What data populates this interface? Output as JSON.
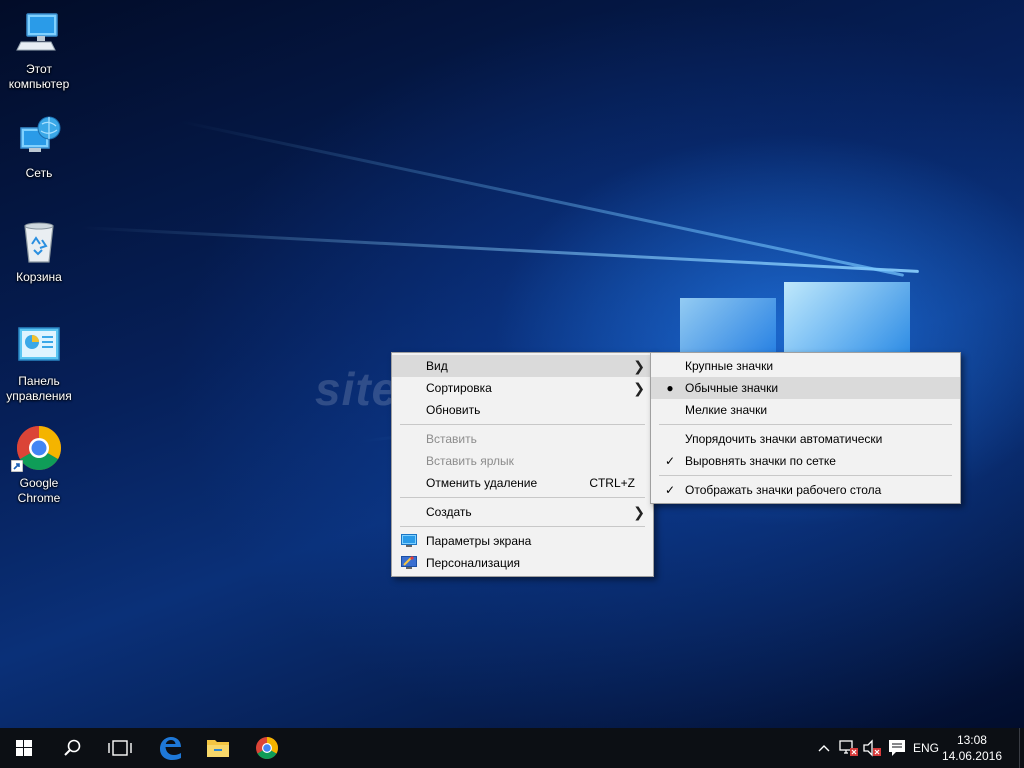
{
  "desktop": {
    "watermark": "site-voks.ru",
    "icons": [
      {
        "label": "Этот\nкомпьютер",
        "icon": "computer-icon"
      },
      {
        "label": "Сеть",
        "icon": "network-icon"
      },
      {
        "label": "Корзина",
        "icon": "recycle-bin-icon"
      },
      {
        "label": "Панель\nуправления",
        "icon": "control-panel-icon"
      },
      {
        "label": "Google\nChrome",
        "icon": "chrome-icon"
      }
    ]
  },
  "context_menu": {
    "view": "Вид",
    "sort": "Сортировка",
    "refresh": "Обновить",
    "paste": "Вставить",
    "paste_shortcut": "Вставить ярлык",
    "undo_delete": "Отменить удаление",
    "undo_shortcut": "CTRL+Z",
    "new": "Создать",
    "display_settings": "Параметры экрана",
    "personalize": "Персонализация"
  },
  "view_submenu": {
    "large_icons": "Крупные значки",
    "medium_icons": "Обычные значки",
    "small_icons": "Мелкие значки",
    "auto_arrange": "Упорядочить значки автоматически",
    "align_grid": "Выровнять значки по сетке",
    "show_icons": "Отображать значки рабочего стола"
  },
  "taskbar": {
    "language": "ENG",
    "time": "13:08",
    "date": "14.06.2016",
    "colors": {
      "background": "#0c0f14",
      "edge_blue": "#1e78d8"
    }
  }
}
